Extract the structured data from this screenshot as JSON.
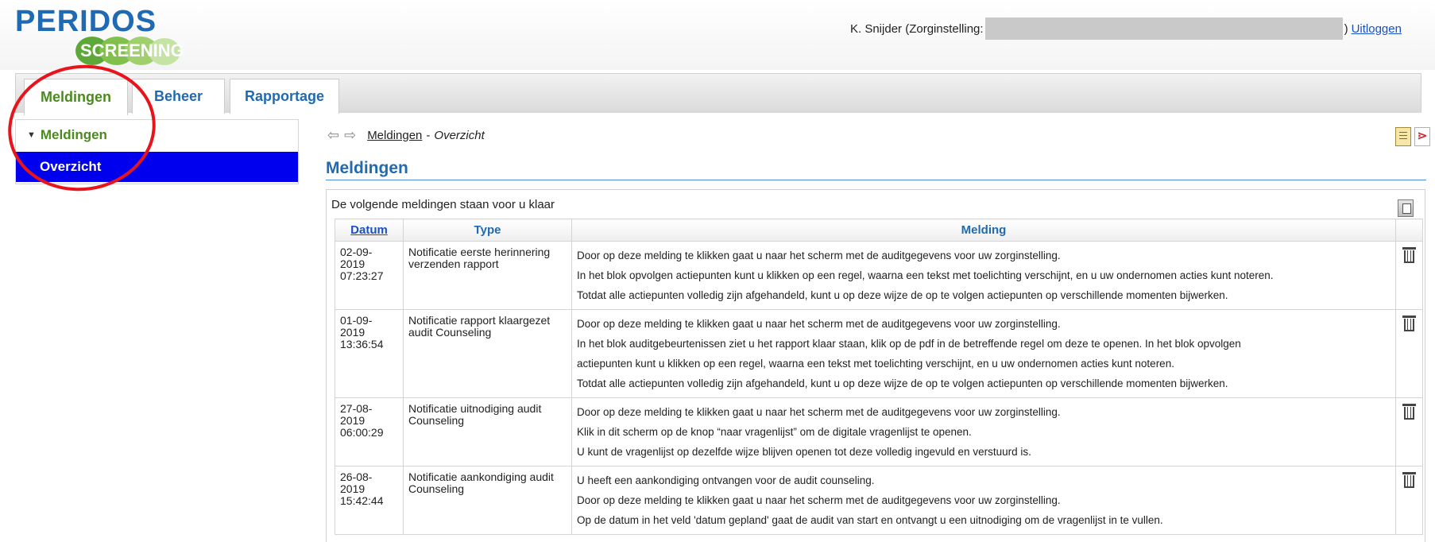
{
  "header": {
    "logo_main": "PERIDOS",
    "logo_sub": "SCREENING",
    "user_prefix": "K. Snijder (Zorginstelling:",
    "user_suffix": ")",
    "logout_label": "Uitloggen"
  },
  "tabs": [
    {
      "label": "Meldingen",
      "active": true
    },
    {
      "label": "Beheer",
      "active": false
    },
    {
      "label": "Rapportage",
      "active": false
    }
  ],
  "sidebar": {
    "section_label": "Meldingen",
    "items": [
      {
        "label": "Overzicht",
        "selected": true
      }
    ]
  },
  "breadcrumb": {
    "link": "Meldingen",
    "separator": "-",
    "current": "Overzicht"
  },
  "page_title": "Meldingen",
  "panel": {
    "intro": "De volgende meldingen staan voor u klaar",
    "columns": [
      "Datum",
      "Type",
      "Melding"
    ],
    "rows": [
      {
        "date": [
          "02-09-",
          "2019",
          "07:23:27"
        ],
        "type": "Notificatie eerste herinnering verzenden rapport",
        "lines": [
          "Door op deze melding te klikken gaat u naar het scherm met de auditgegevens voor uw zorginstelling.",
          "In het blok opvolgen actiepunten kunt u klikken op een regel, waarna een tekst met toelichting verschijnt, en u uw ondernomen acties kunt noteren.",
          "Totdat alle actiepunten volledig zijn afgehandeld, kunt u op deze wijze de op te volgen actiepunten op verschillende momenten bijwerken."
        ]
      },
      {
        "date": [
          "01-09-",
          "2019",
          "13:36:54"
        ],
        "type": "Notificatie rapport klaargezet audit Counseling",
        "lines": [
          "Door op deze melding te klikken gaat u naar het scherm met de auditgegevens voor uw zorginstelling.",
          "In het blok auditgebeurtenissen ziet u het rapport klaar staan, klik op de pdf in de betreffende regel om deze te openen. In het blok opvolgen",
          "actiepunten kunt u klikken op een regel, waarna een tekst met toelichting verschijnt, en u uw ondernomen acties kunt noteren.",
          "Totdat alle actiepunten volledig zijn afgehandeld, kunt u op deze wijze de op te volgen actiepunten op verschillende momenten bijwerken."
        ]
      },
      {
        "date": [
          "27-08-",
          "2019",
          "06:00:29"
        ],
        "type": "Notificatie uitnodiging audit Counseling",
        "lines": [
          "Door op deze melding te klikken gaat u naar het scherm met de auditgegevens voor uw zorginstelling.",
          "Klik in dit scherm op de knop “naar vragenlijst” om de digitale vragenlijst te openen.",
          "U kunt de vragenlijst op dezelfde wijze blijven openen tot deze volledig ingevuld en verstuurd is."
        ]
      },
      {
        "date": [
          "26-08-",
          "2019",
          "15:42:44"
        ],
        "type": "Notificatie aankondiging audit Counseling",
        "lines": [
          "U heeft een aankondiging ontvangen voor de audit counseling.",
          "Door op deze melding te klikken gaat u naar het scherm met de auditgegevens voor uw zorginstelling.",
          "Op de datum in het veld 'datum gepland' gaat de audit van start en ontvangt u een uitnodiging om de vragenlijst in te vullen."
        ]
      }
    ]
  },
  "colors": {
    "brand_blue": "#1f6ab2",
    "brand_green": "#4a8a1e",
    "selected_bg": "#0000ee",
    "annotation_red": "#e8141c"
  },
  "icons": [
    "arrow-left-icon",
    "arrow-right-icon",
    "document-icon",
    "pdf-icon",
    "copy-icon",
    "trash-icon",
    "caret-down-icon"
  ]
}
